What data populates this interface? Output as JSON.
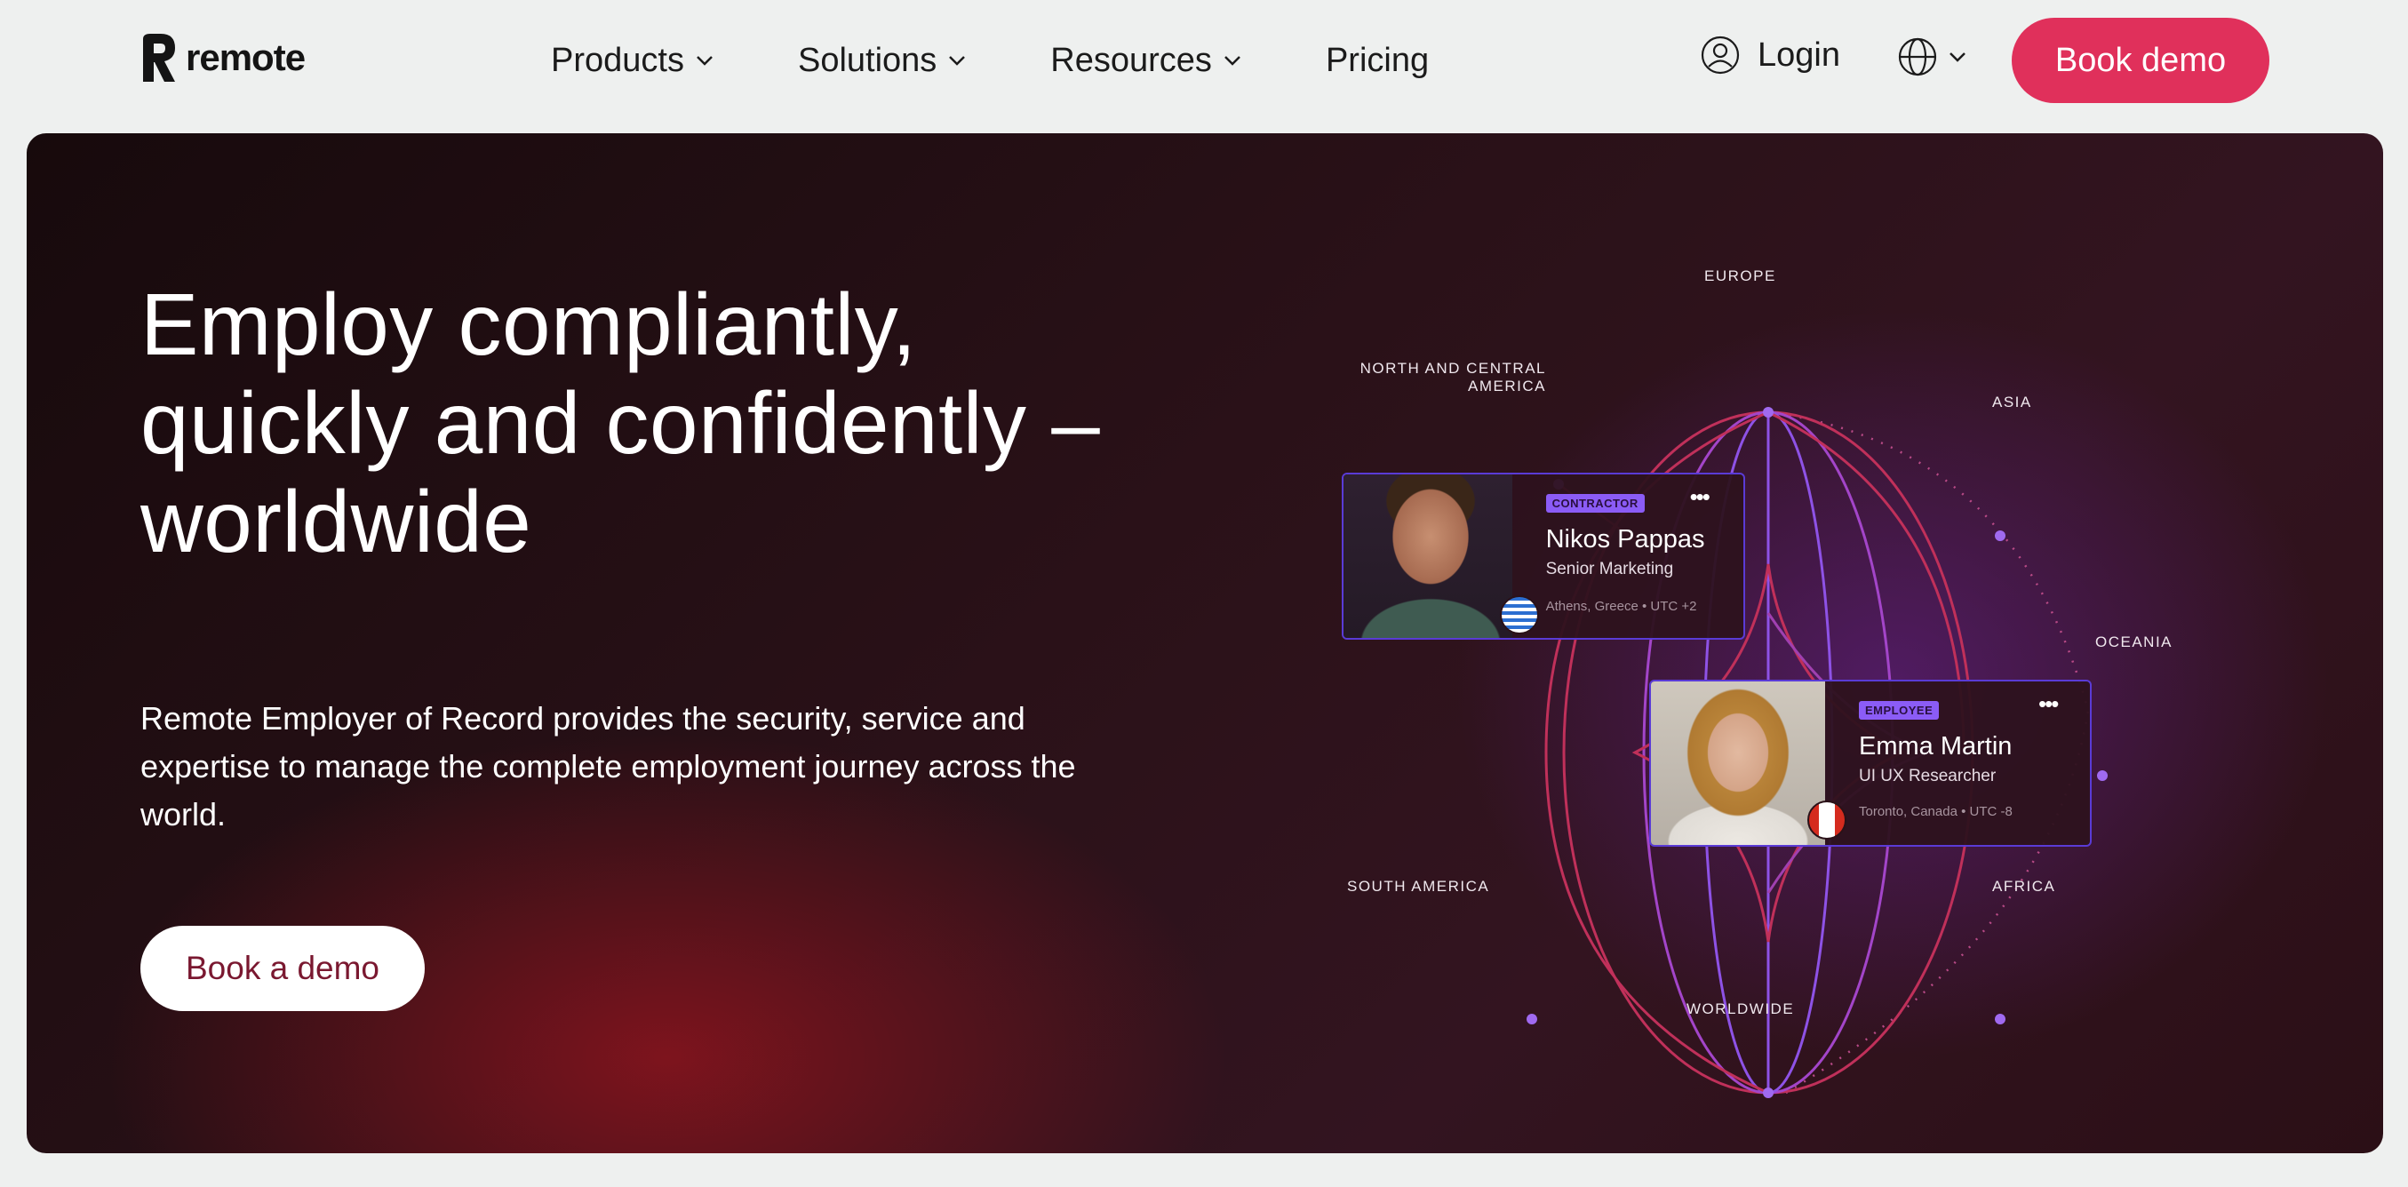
{
  "nav": {
    "logo": "remote",
    "menu": [
      {
        "label": "Products"
      },
      {
        "label": "Solutions"
      },
      {
        "label": "Resources"
      },
      {
        "label": "Pricing"
      }
    ],
    "login_label": "Login",
    "book_demo_label": "Book demo"
  },
  "hero": {
    "headline": "Employ compliantly, quickly and confidently – worldwide",
    "subtext": "Remote Employer of Record provides the security, service and expertise to manage the complete employment journey across the world.",
    "cta_label": "Book a demo",
    "regions": {
      "europe": "EUROPE",
      "na_line1": "NORTH AND CENTRAL",
      "na_line2": "AMERICA",
      "asia": "ASIA",
      "oceania": "OCEANIA",
      "south_america": "SOUTH AMERICA",
      "africa": "AFRICA",
      "worldwide": "WORLDWIDE"
    },
    "cards": [
      {
        "badge": "CONTRACTOR",
        "name": "Nikos Pappas",
        "role": "Senior Marketing",
        "location": "Athens, Greece",
        "utc": "UTC +2"
      },
      {
        "badge": "EMPLOYEE",
        "name": "Emma Martin",
        "role": "UI UX Researcher",
        "location": "Toronto, Canada",
        "utc": "UTC -8"
      }
    ]
  },
  "colors": {
    "accent": "#e0305b",
    "purple": "#8b5cf6",
    "nav_bg": "#eef0ef"
  }
}
